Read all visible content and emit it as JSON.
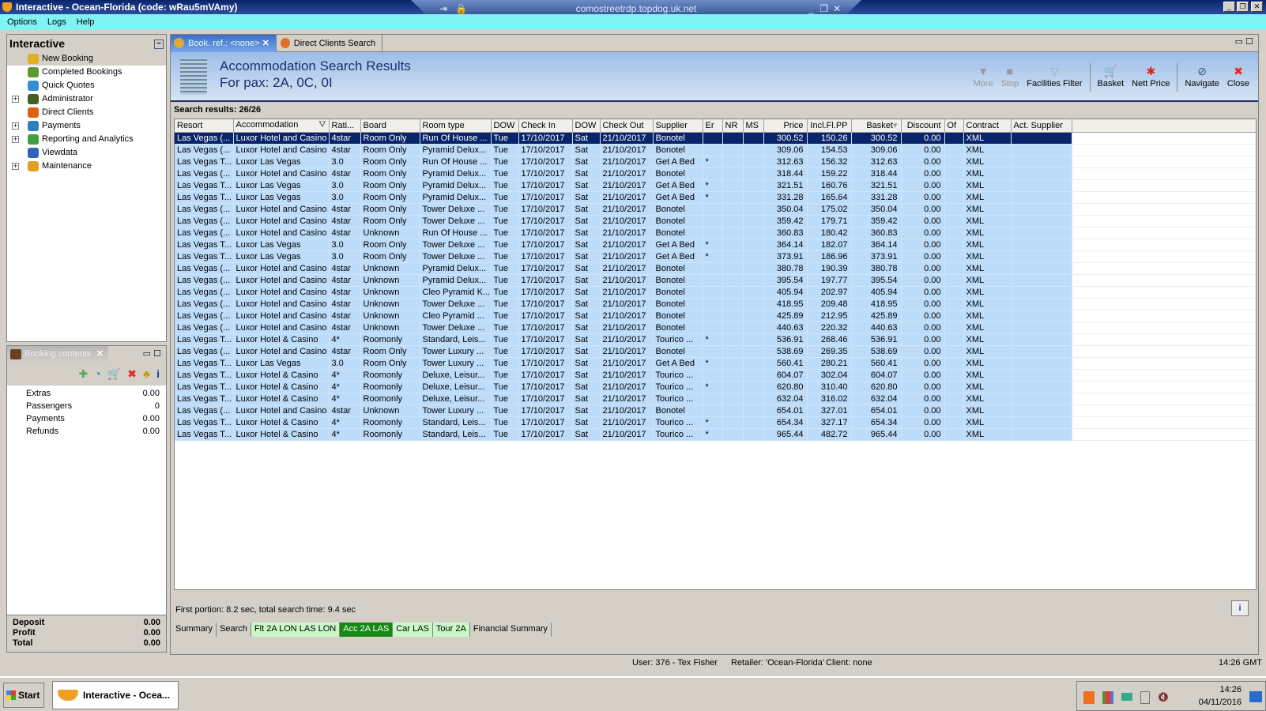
{
  "window": {
    "title": "Interactive - Ocean-Florida (code: wRau5mVAmy)",
    "remote_host": "comostreetrdp.topdog.uk.net"
  },
  "menu": [
    "Options",
    "Logs",
    "Help"
  ],
  "nav": {
    "title": "Interactive",
    "items": [
      {
        "label": "New Booking",
        "expandable": false,
        "color": "#e0b020"
      },
      {
        "label": "Completed Bookings",
        "expandable": false,
        "color": "#5a9a30"
      },
      {
        "label": "Quick Quotes",
        "expandable": false,
        "color": "#3a8ad0"
      },
      {
        "label": "Administrator",
        "expandable": true,
        "color": "#406020"
      },
      {
        "label": "Direct Clients",
        "expandable": false,
        "color": "#e06010"
      },
      {
        "label": "Payments",
        "expandable": true,
        "color": "#2a80c0"
      },
      {
        "label": "Reporting and Analytics",
        "expandable": true,
        "color": "#40a040"
      },
      {
        "label": "Viewdata",
        "expandable": false,
        "color": "#3060c0"
      },
      {
        "label": "Maintenance",
        "expandable": true,
        "color": "#e0a020"
      }
    ]
  },
  "booking_contents": {
    "title": "Booking contents",
    "rows": [
      {
        "label": "Extras",
        "value": "0.00"
      },
      {
        "label": "Passengers",
        "value": "0"
      },
      {
        "label": "Payments",
        "value": "0.00"
      },
      {
        "label": "Refunds",
        "value": "0.00"
      }
    ],
    "totals": [
      {
        "label": "Deposit",
        "value": "0.00"
      },
      {
        "label": "Profit",
        "value": "0.00"
      },
      {
        "label": "Total",
        "value": "0.00"
      }
    ]
  },
  "doc_tabs": [
    "Book. ref.: <none>",
    "Direct Clients Search"
  ],
  "banner": {
    "title": "Accommodation Search Results",
    "subtitle": "For pax: 2A, 0C, 0I"
  },
  "toolbar": {
    "more": "More",
    "stop": "Stop",
    "facilities": "Facilities Filter",
    "basket": "Basket",
    "nett": "Nett Price",
    "navigate": "Navigate",
    "close": "Close"
  },
  "results_count": "Search results: 26/26",
  "columns": [
    "Resort",
    "Accommodation",
    "Rati...",
    "Board",
    "Room type",
    "DOW",
    "Check In",
    "DOW",
    "Check Out",
    "Supplier",
    "Er",
    "NR",
    "MS",
    "Price",
    "Incl.Fl.PP",
    "Basket",
    "Discount",
    "Of",
    "Contract",
    "Act. Supplier"
  ],
  "rows": [
    [
      "Las Vegas (...",
      "Luxor Hotel and Casino",
      "4star",
      "Room Only",
      "Run Of House ...",
      "Tue",
      "17/10/2017",
      "Sat",
      "21/10/2017",
      "Bonotel",
      "",
      "",
      "",
      "300.52",
      "150.26",
      "300.52",
      "0.00",
      "",
      "XML",
      ""
    ],
    [
      "Las Vegas (...",
      "Luxor Hotel and Casino",
      "4star",
      "Room Only",
      "Pyramid Delux...",
      "Tue",
      "17/10/2017",
      "Sat",
      "21/10/2017",
      "Bonotel",
      "",
      "",
      "",
      "309.06",
      "154.53",
      "309.06",
      "0.00",
      "",
      "XML",
      ""
    ],
    [
      "Las Vegas T...",
      "Luxor Las Vegas",
      "3.0",
      "Room Only",
      "Run Of House ...",
      "Tue",
      "17/10/2017",
      "Sat",
      "21/10/2017",
      "Get A Bed",
      "*",
      "",
      "",
      "312.63",
      "156.32",
      "312.63",
      "0.00",
      "",
      "XML",
      ""
    ],
    [
      "Las Vegas (...",
      "Luxor Hotel and Casino",
      "4star",
      "Room Only",
      "Pyramid Delux...",
      "Tue",
      "17/10/2017",
      "Sat",
      "21/10/2017",
      "Bonotel",
      "",
      "",
      "",
      "318.44",
      "159.22",
      "318.44",
      "0.00",
      "",
      "XML",
      ""
    ],
    [
      "Las Vegas T...",
      "Luxor Las Vegas",
      "3.0",
      "Room Only",
      "Pyramid Delux...",
      "Tue",
      "17/10/2017",
      "Sat",
      "21/10/2017",
      "Get A Bed",
      "*",
      "",
      "",
      "321.51",
      "160.76",
      "321.51",
      "0.00",
      "",
      "XML",
      ""
    ],
    [
      "Las Vegas T...",
      "Luxor Las Vegas",
      "3.0",
      "Room Only",
      "Pyramid Delux...",
      "Tue",
      "17/10/2017",
      "Sat",
      "21/10/2017",
      "Get A Bed",
      "*",
      "",
      "",
      "331.28",
      "165.64",
      "331.28",
      "0.00",
      "",
      "XML",
      ""
    ],
    [
      "Las Vegas (...",
      "Luxor Hotel and Casino",
      "4star",
      "Room Only",
      "Tower Deluxe ...",
      "Tue",
      "17/10/2017",
      "Sat",
      "21/10/2017",
      "Bonotel",
      "",
      "",
      "",
      "350.04",
      "175.02",
      "350.04",
      "0.00",
      "",
      "XML",
      ""
    ],
    [
      "Las Vegas (...",
      "Luxor Hotel and Casino",
      "4star",
      "Room Only",
      "Tower Deluxe ...",
      "Tue",
      "17/10/2017",
      "Sat",
      "21/10/2017",
      "Bonotel",
      "",
      "",
      "",
      "359.42",
      "179.71",
      "359.42",
      "0.00",
      "",
      "XML",
      ""
    ],
    [
      "Las Vegas (...",
      "Luxor Hotel and Casino",
      "4star",
      "Unknown",
      "Run Of House ...",
      "Tue",
      "17/10/2017",
      "Sat",
      "21/10/2017",
      "Bonotel",
      "",
      "",
      "",
      "360.83",
      "180.42",
      "360.83",
      "0.00",
      "",
      "XML",
      ""
    ],
    [
      "Las Vegas T...",
      "Luxor Las Vegas",
      "3.0",
      "Room Only",
      "Tower Deluxe ...",
      "Tue",
      "17/10/2017",
      "Sat",
      "21/10/2017",
      "Get A Bed",
      "*",
      "",
      "",
      "364.14",
      "182.07",
      "364.14",
      "0.00",
      "",
      "XML",
      ""
    ],
    [
      "Las Vegas T...",
      "Luxor Las Vegas",
      "3.0",
      "Room Only",
      "Tower Deluxe ...",
      "Tue",
      "17/10/2017",
      "Sat",
      "21/10/2017",
      "Get A Bed",
      "*",
      "",
      "",
      "373.91",
      "186.96",
      "373.91",
      "0.00",
      "",
      "XML",
      ""
    ],
    [
      "Las Vegas (...",
      "Luxor Hotel and Casino",
      "4star",
      "Unknown",
      "Pyramid Delux...",
      "Tue",
      "17/10/2017",
      "Sat",
      "21/10/2017",
      "Bonotel",
      "",
      "",
      "",
      "380.78",
      "190.39",
      "380.78",
      "0.00",
      "",
      "XML",
      ""
    ],
    [
      "Las Vegas (...",
      "Luxor Hotel and Casino",
      "4star",
      "Unknown",
      "Pyramid Delux...",
      "Tue",
      "17/10/2017",
      "Sat",
      "21/10/2017",
      "Bonotel",
      "",
      "",
      "",
      "395.54",
      "197.77",
      "395.54",
      "0.00",
      "",
      "XML",
      ""
    ],
    [
      "Las Vegas (...",
      "Luxor Hotel and Casino",
      "4star",
      "Unknown",
      "Cleo Pyramid K...",
      "Tue",
      "17/10/2017",
      "Sat",
      "21/10/2017",
      "Bonotel",
      "",
      "",
      "",
      "405.94",
      "202.97",
      "405.94",
      "0.00",
      "",
      "XML",
      ""
    ],
    [
      "Las Vegas (...",
      "Luxor Hotel and Casino",
      "4star",
      "Unknown",
      "Tower Deluxe ...",
      "Tue",
      "17/10/2017",
      "Sat",
      "21/10/2017",
      "Bonotel",
      "",
      "",
      "",
      "418.95",
      "209.48",
      "418.95",
      "0.00",
      "",
      "XML",
      ""
    ],
    [
      "Las Vegas (...",
      "Luxor Hotel and Casino",
      "4star",
      "Unknown",
      "Cleo Pyramid ...",
      "Tue",
      "17/10/2017",
      "Sat",
      "21/10/2017",
      "Bonotel",
      "",
      "",
      "",
      "425.89",
      "212.95",
      "425.89",
      "0.00",
      "",
      "XML",
      ""
    ],
    [
      "Las Vegas (...",
      "Luxor Hotel and Casino",
      "4star",
      "Unknown",
      "Tower Deluxe ...",
      "Tue",
      "17/10/2017",
      "Sat",
      "21/10/2017",
      "Bonotel",
      "",
      "",
      "",
      "440.63",
      "220.32",
      "440.63",
      "0.00",
      "",
      "XML",
      ""
    ],
    [
      "Las Vegas T...",
      "Luxor Hotel & Casino",
      "4*",
      "Roomonly",
      "Standard, Leis...",
      "Tue",
      "17/10/2017",
      "Sat",
      "21/10/2017",
      "Tourico ...",
      "*",
      "",
      "",
      "536.91",
      "268.46",
      "536.91",
      "0.00",
      "",
      "XML",
      ""
    ],
    [
      "Las Vegas (...",
      "Luxor Hotel and Casino",
      "4star",
      "Room Only",
      "Tower Luxury ...",
      "Tue",
      "17/10/2017",
      "Sat",
      "21/10/2017",
      "Bonotel",
      "",
      "",
      "",
      "538.69",
      "269.35",
      "538.69",
      "0.00",
      "",
      "XML",
      ""
    ],
    [
      "Las Vegas T...",
      "Luxor Las Vegas",
      "3.0",
      "Room Only",
      "Tower Luxury ...",
      "Tue",
      "17/10/2017",
      "Sat",
      "21/10/2017",
      "Get A Bed",
      "*",
      "",
      "",
      "560.41",
      "280.21",
      "560.41",
      "0.00",
      "",
      "XML",
      ""
    ],
    [
      "Las Vegas T...",
      "Luxor Hotel & Casino",
      "4*",
      "Roomonly",
      "Deluxe, Leisur...",
      "Tue",
      "17/10/2017",
      "Sat",
      "21/10/2017",
      "Tourico ...",
      "",
      "",
      "",
      "604.07",
      "302.04",
      "604.07",
      "0.00",
      "",
      "XML",
      ""
    ],
    [
      "Las Vegas T...",
      "Luxor Hotel & Casino",
      "4*",
      "Roomonly",
      "Deluxe, Leisur...",
      "Tue",
      "17/10/2017",
      "Sat",
      "21/10/2017",
      "Tourico ...",
      "*",
      "",
      "",
      "620.80",
      "310.40",
      "620.80",
      "0.00",
      "",
      "XML",
      ""
    ],
    [
      "Las Vegas T...",
      "Luxor Hotel & Casino",
      "4*",
      "Roomonly",
      "Deluxe, Leisur...",
      "Tue",
      "17/10/2017",
      "Sat",
      "21/10/2017",
      "Tourico ...",
      "",
      "",
      "",
      "632.04",
      "316.02",
      "632.04",
      "0.00",
      "",
      "XML",
      ""
    ],
    [
      "Las Vegas (...",
      "Luxor Hotel and Casino",
      "4star",
      "Unknown",
      "Tower Luxury ...",
      "Tue",
      "17/10/2017",
      "Sat",
      "21/10/2017",
      "Bonotel",
      "",
      "",
      "",
      "654.01",
      "327.01",
      "654.01",
      "0.00",
      "",
      "XML",
      ""
    ],
    [
      "Las Vegas T...",
      "Luxor Hotel & Casino",
      "4*",
      "Roomonly",
      "Standard, Leis...",
      "Tue",
      "17/10/2017",
      "Sat",
      "21/10/2017",
      "Tourico ...",
      "*",
      "",
      "",
      "654.34",
      "327.17",
      "654.34",
      "0.00",
      "",
      "XML",
      ""
    ],
    [
      "Las Vegas T...",
      "Luxor Hotel & Casino",
      "4*",
      "Roomonly",
      "Standard, Leis...",
      "Tue",
      "17/10/2017",
      "Sat",
      "21/10/2017",
      "Tourico ...",
      "*",
      "",
      "",
      "965.44",
      "482.72",
      "965.44",
      "0.00",
      "",
      "XML",
      ""
    ]
  ],
  "search_info": "First portion: 8.2 sec, total search time: 9.4 sec",
  "bottom_tabs": [
    {
      "label": "Summary",
      "state": "normal"
    },
    {
      "label": "Search",
      "state": "normal"
    },
    {
      "label": "Flt 2A LON LAS LON",
      "state": "light"
    },
    {
      "label": "Acc 2A LAS",
      "state": "active"
    },
    {
      "label": "Car LAS",
      "state": "light"
    },
    {
      "label": "Tour 2A",
      "state": "light"
    },
    {
      "label": "Financial Summary",
      "state": "normal"
    }
  ],
  "status": {
    "user": "User: 376 - Tex Fisher",
    "retailer": "Retailer: 'Ocean-Florida'",
    "client": "Client: none",
    "time": "14:26 GMT"
  },
  "taskbar": {
    "start": "Start",
    "task": "Interactive - Ocea...",
    "clock_time": "14:26",
    "clock_date": "04/11/2016"
  }
}
